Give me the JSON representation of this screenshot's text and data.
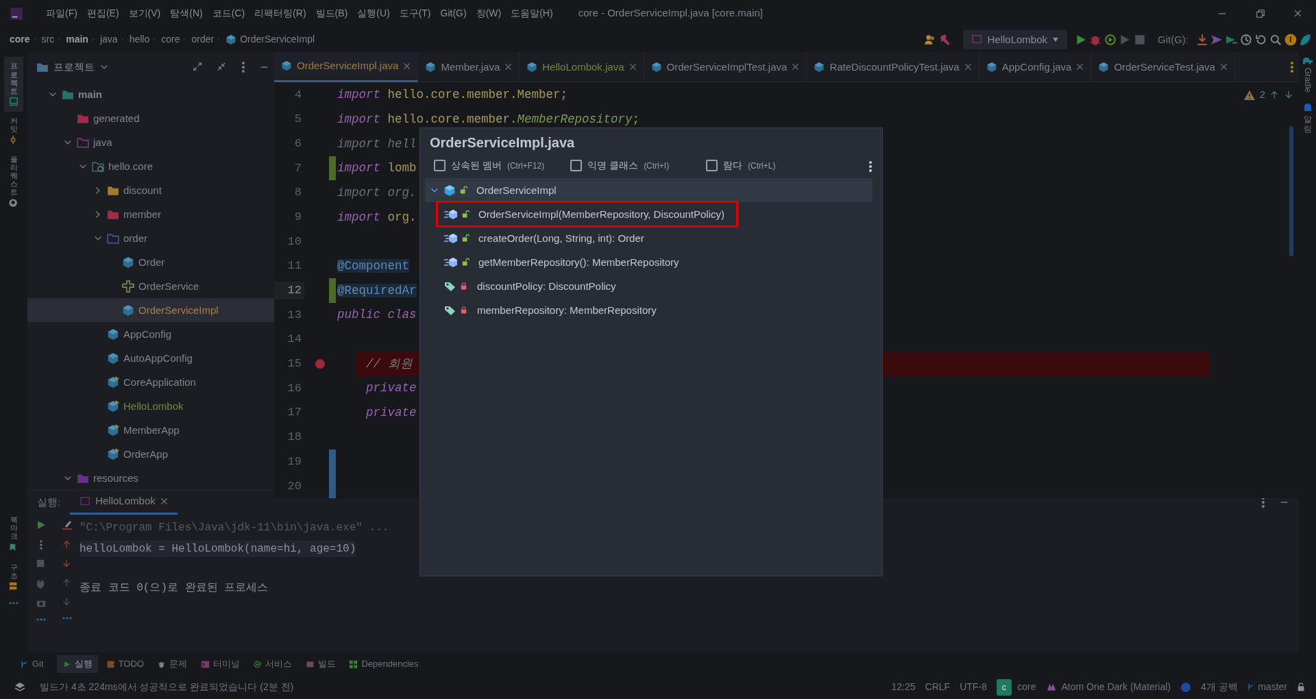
{
  "menu": [
    "파일(F)",
    "편집(E)",
    "보기(V)",
    "탐색(N)",
    "코드(C)",
    "리팩터링(R)",
    "빌드(B)",
    "실행(U)",
    "도구(T)",
    "Git(G)",
    "창(W)",
    "도움말(H)"
  ],
  "window_title": "core - OrderServiceImpl.java [core.main]",
  "breadcrumbs": [
    {
      "label": "core",
      "bold": true
    },
    {
      "label": "src",
      "bold": false
    },
    {
      "label": "main",
      "bold": true
    },
    {
      "label": "java",
      "bold": false
    },
    {
      "label": "hello",
      "bold": false
    },
    {
      "label": "core",
      "bold": false
    },
    {
      "label": "order",
      "bold": false
    },
    {
      "label": "OrderServiceImpl",
      "bold": false,
      "kind": "class"
    }
  ],
  "run_config": "HelloLombok",
  "git_label": "Git(G):",
  "left_strip": [
    {
      "label": "프로젝트",
      "selected": true
    },
    {
      "label": "커밋",
      "selected": false
    },
    {
      "label": "풀 리퀘스트",
      "selected": false
    }
  ],
  "left_strip_bottom": [
    {
      "label": "북마크"
    },
    {
      "label": "구조"
    }
  ],
  "project": {
    "title": "프로젝트",
    "tree": [
      {
        "label": "main",
        "kind": "module-folder",
        "bold": true,
        "expanded": true,
        "selected": false,
        "modified": false,
        "added": false,
        "children": [
          {
            "label": "generated",
            "kind": "generated-folder",
            "bold": false,
            "selected": false,
            "modified": false,
            "added": false
          },
          {
            "label": "java",
            "kind": "source-folder",
            "bold": false,
            "expanded": true,
            "selected": false,
            "modified": false,
            "added": false,
            "children": [
              {
                "label": "hello.core",
                "kind": "package",
                "bold": false,
                "expanded": true,
                "selected": false,
                "modified": false,
                "added": false,
                "children": [
                  {
                    "label": "discount",
                    "kind": "folder",
                    "bold": false,
                    "expanded": false,
                    "selected": false,
                    "modified": false,
                    "added": false
                  },
                  {
                    "label": "member",
                    "kind": "member-folder",
                    "bold": false,
                    "expanded": false,
                    "selected": false,
                    "modified": false,
                    "added": false
                  },
                  {
                    "label": "order",
                    "kind": "plain-folder",
                    "bold": false,
                    "expanded": true,
                    "selected": false,
                    "modified": false,
                    "added": false,
                    "children": [
                      {
                        "label": "Order",
                        "kind": "class",
                        "bold": false,
                        "selected": false,
                        "modified": false,
                        "added": false
                      },
                      {
                        "label": "OrderService",
                        "kind": "interface",
                        "bold": false,
                        "selected": false,
                        "modified": false,
                        "added": false
                      },
                      {
                        "label": "OrderServiceImpl",
                        "kind": "class",
                        "bold": false,
                        "selected": true,
                        "modified": true,
                        "added": false
                      }
                    ]
                  },
                  {
                    "label": "AppConfig",
                    "kind": "class",
                    "bold": false,
                    "selected": false,
                    "modified": false,
                    "added": false
                  },
                  {
                    "label": "AutoAppConfig",
                    "kind": "class",
                    "bold": false,
                    "selected": false,
                    "modified": false,
                    "added": false
                  },
                  {
                    "label": "CoreApplication",
                    "kind": "main-class",
                    "bold": false,
                    "selected": false,
                    "modified": false,
                    "added": false
                  },
                  {
                    "label": "HelloLombok",
                    "kind": "main-class",
                    "bold": false,
                    "selected": false,
                    "modified": false,
                    "added": true
                  },
                  {
                    "label": "MemberApp",
                    "kind": "main-class",
                    "bold": false,
                    "selected": false,
                    "modified": false,
                    "added": false
                  },
                  {
                    "label": "OrderApp",
                    "kind": "main-class",
                    "bold": false,
                    "selected": false,
                    "modified": false,
                    "added": false
                  }
                ]
              }
            ]
          },
          {
            "label": "resources",
            "kind": "resources-folder",
            "bold": false,
            "expanded": true,
            "selected": false,
            "modified": false,
            "added": false
          }
        ]
      }
    ]
  },
  "tabs": [
    {
      "label": "OrderServiceImpl.java",
      "selected": true,
      "modified": true,
      "added": false
    },
    {
      "label": "Member.java",
      "selected": false,
      "modified": false,
      "added": false
    },
    {
      "label": "HelloLombok.java",
      "selected": false,
      "modified": false,
      "added": true
    },
    {
      "label": "OrderServiceImplTest.java",
      "selected": false,
      "modified": false,
      "added": false
    },
    {
      "label": "RateDiscountPolicyTest.java",
      "selected": false,
      "modified": false,
      "added": false
    },
    {
      "label": "AppConfig.java",
      "selected": false,
      "modified": false,
      "added": false
    },
    {
      "label": "OrderServiceTest.java",
      "selected": false,
      "modified": false,
      "added": false
    }
  ],
  "warnings": "2",
  "code_lines": [
    {
      "number": "4",
      "current": false,
      "breakpoint": false,
      "added": false,
      "modified": false,
      "segments": [
        {
          "text": "import",
          "kind": "keyword"
        },
        {
          "text": " hello.core.member.Member;",
          "kind": "plain"
        }
      ]
    },
    {
      "number": "5",
      "current": false,
      "breakpoint": false,
      "added": false,
      "modified": false,
      "segments": [
        {
          "text": "import",
          "kind": "keyword"
        },
        {
          "text": " hello.core.member.",
          "kind": "plain"
        },
        {
          "text": "MemberRepository",
          "kind": "type"
        },
        {
          "text": ";",
          "kind": "plain"
        }
      ]
    },
    {
      "number": "6",
      "current": false,
      "breakpoint": false,
      "added": false,
      "modified": false,
      "segments": [
        {
          "text": "import hell",
          "kind": "unused"
        }
      ]
    },
    {
      "number": "7",
      "current": false,
      "breakpoint": false,
      "added": true,
      "modified": false,
      "segments": [
        {
          "text": "import",
          "kind": "keyword"
        },
        {
          "text": " lomb",
          "kind": "plain"
        }
      ]
    },
    {
      "number": "8",
      "current": false,
      "breakpoint": false,
      "added": false,
      "modified": false,
      "segments": [
        {
          "text": "import org.",
          "kind": "unused"
        }
      ]
    },
    {
      "number": "9",
      "current": false,
      "breakpoint": false,
      "added": false,
      "modified": false,
      "segments": [
        {
          "text": "import",
          "kind": "keyword"
        },
        {
          "text": " org.",
          "kind": "plain"
        }
      ]
    },
    {
      "number": "10",
      "current": false,
      "breakpoint": false,
      "added": false,
      "modified": false
    },
    {
      "number": "11",
      "current": false,
      "breakpoint": false,
      "added": false,
      "modified": false,
      "segments": [
        {
          "text": "@Component",
          "kind": "annotation"
        }
      ]
    },
    {
      "number": "12",
      "current": true,
      "breakpoint": false,
      "added": true,
      "modified": false,
      "segments": [
        {
          "text": "@RequiredAr",
          "kind": "annotation"
        }
      ]
    },
    {
      "number": "13",
      "current": false,
      "breakpoint": false,
      "added": false,
      "modified": false,
      "segments": [
        {
          "text": "public clas",
          "kind": "keyword"
        }
      ]
    },
    {
      "number": "14",
      "current": false,
      "breakpoint": false,
      "added": false,
      "modified": false
    },
    {
      "number": "15",
      "current": false,
      "breakpoint": true,
      "added": false,
      "modified": false,
      "segments": [
        {
          "text": "    // 회원",
          "kind": "comment"
        }
      ]
    },
    {
      "number": "16",
      "current": false,
      "breakpoint": false,
      "added": false,
      "modified": false,
      "segments": [
        {
          "text": "    private",
          "kind": "keyword"
        }
      ]
    },
    {
      "number": "17",
      "current": false,
      "breakpoint": false,
      "added": false,
      "modified": false,
      "segments": [
        {
          "text": "    private",
          "kind": "keyword"
        }
      ]
    },
    {
      "number": "18",
      "current": false,
      "breakpoint": false,
      "added": false,
      "modified": false
    },
    {
      "number": "19",
      "current": false,
      "breakpoint": false,
      "added": false,
      "modified": true
    },
    {
      "number": "20",
      "current": false,
      "breakpoint": false,
      "added": false,
      "modified": true
    }
  ],
  "popup": {
    "title": "OrderServiceImpl.java",
    "options": [
      {
        "label": "상속된 멤버",
        "shortcut": "(Ctrl+F12)",
        "checked": false
      },
      {
        "label": "익명 클래스",
        "shortcut": "(Ctrl+I)",
        "checked": false
      },
      {
        "label": "람다",
        "shortcut": "(Ctrl+L)",
        "checked": false
      }
    ],
    "root": {
      "label": "OrderServiceImpl",
      "expanded": true,
      "selected": true,
      "children": [
        {
          "label": "OrderServiceImpl(MemberRepository, DiscountPolicy)",
          "kind": "method",
          "locked": false,
          "highlighted": true
        },
        {
          "label": "createOrder(Long, String, int): Order",
          "kind": "method",
          "locked": false,
          "highlighted": false
        },
        {
          "label": "getMemberRepository(): MemberRepository",
          "kind": "method",
          "locked": false,
          "highlighted": false
        },
        {
          "label": "discountPolicy: DiscountPolicy",
          "kind": "field",
          "locked": true,
          "highlighted": false
        },
        {
          "label": "memberRepository: MemberRepository",
          "kind": "field",
          "locked": true,
          "highlighted": false
        }
      ]
    }
  },
  "run_panel": {
    "label": "실행:",
    "tab": "HelloLombok",
    "console": [
      {
        "text": "\"C:\\Program Files\\Java\\jdk-11\\bin\\java.exe\" ...",
        "kind": "command"
      },
      {
        "text": "helloLombok = HelloLombok(name=hi, age=10)",
        "kind": "output"
      },
      {
        "text": "종료 코드 0(으)로 완료된 프로세스",
        "kind": "exit"
      }
    ]
  },
  "tool_tabs": [
    {
      "label": "Git",
      "selected": false
    },
    {
      "label": "실행",
      "selected": true
    },
    {
      "label": "TODO",
      "selected": false
    },
    {
      "label": "문제",
      "selected": false
    },
    {
      "label": "터미널",
      "selected": false
    },
    {
      "label": "서비스",
      "selected": false
    },
    {
      "label": "빌드",
      "selected": false
    },
    {
      "label": "Dependencies",
      "selected": false
    }
  ],
  "status": {
    "message": "빌드가 4초 224ms에서 성공적으로 완료되었습니다 (2분 전)",
    "position": "12:25",
    "line_ending": "CRLF",
    "encoding": "UTF-8",
    "module_badge": "c",
    "module": "core",
    "theme": "Atom One Dark (Material)",
    "indent": "4개 공백",
    "branch": "master"
  },
  "right_strip": [
    {
      "label": "Gradle",
      "kind": "latin"
    },
    {
      "label": "알림",
      "kind": "korean"
    }
  ]
}
